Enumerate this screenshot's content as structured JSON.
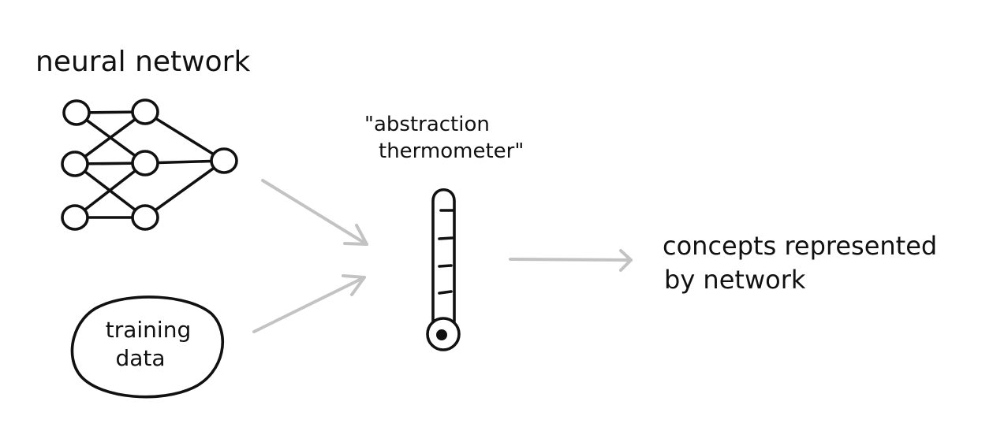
{
  "labels": {
    "neural_network": "neural network",
    "thermometer_line1": "\"abstraction",
    "thermometer_line2": "thermometer\"",
    "training_line1": "training",
    "training_line2": "data",
    "output_line1": "concepts represented",
    "output_line2": "by network"
  },
  "colors": {
    "ink": "#111111",
    "arrow": "#c3c3c3",
    "background": "#ffffff"
  },
  "network": {
    "layers": [
      3,
      3,
      1
    ]
  }
}
